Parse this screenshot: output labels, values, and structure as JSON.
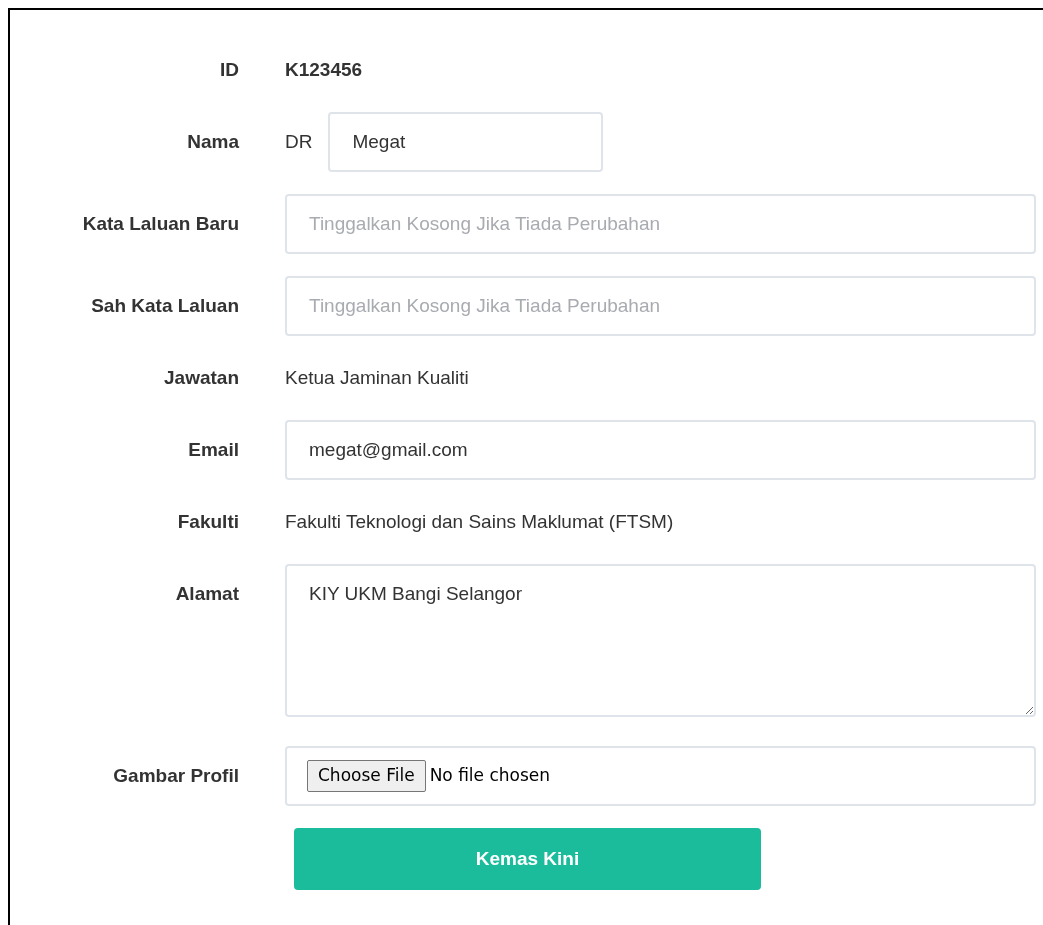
{
  "fields": [
    {
      "kind": "static",
      "label": "ID",
      "value": "K123456",
      "bold": true
    },
    {
      "kind": "titled",
      "label": "Nama",
      "prefix": "DR",
      "value": "Megat"
    },
    {
      "kind": "input",
      "label": "Kata Laluan Baru",
      "placeholder": "Tinggalkan Kosong Jika Tiada Perubahan"
    },
    {
      "kind": "input",
      "label": "Sah Kata Laluan",
      "placeholder": "Tinggalkan Kosong Jika Tiada Perubahan"
    },
    {
      "kind": "static",
      "label": "Jawatan",
      "value": "Ketua Jaminan Kualiti",
      "bold": false
    },
    {
      "kind": "input",
      "label": "Email",
      "value": "megat@gmail.com"
    },
    {
      "kind": "static",
      "label": "Fakulti",
      "value": "Fakulti Teknologi dan Sains Maklumat (FTSM)",
      "bold": false
    },
    {
      "kind": "textarea",
      "label": "Alamat",
      "value": "KIY UKM Bangi Selangor"
    },
    {
      "kind": "file",
      "label": "Gambar Profil",
      "button": "Choose File",
      "status": "No file chosen"
    }
  ],
  "submit": "Kemas Kini"
}
